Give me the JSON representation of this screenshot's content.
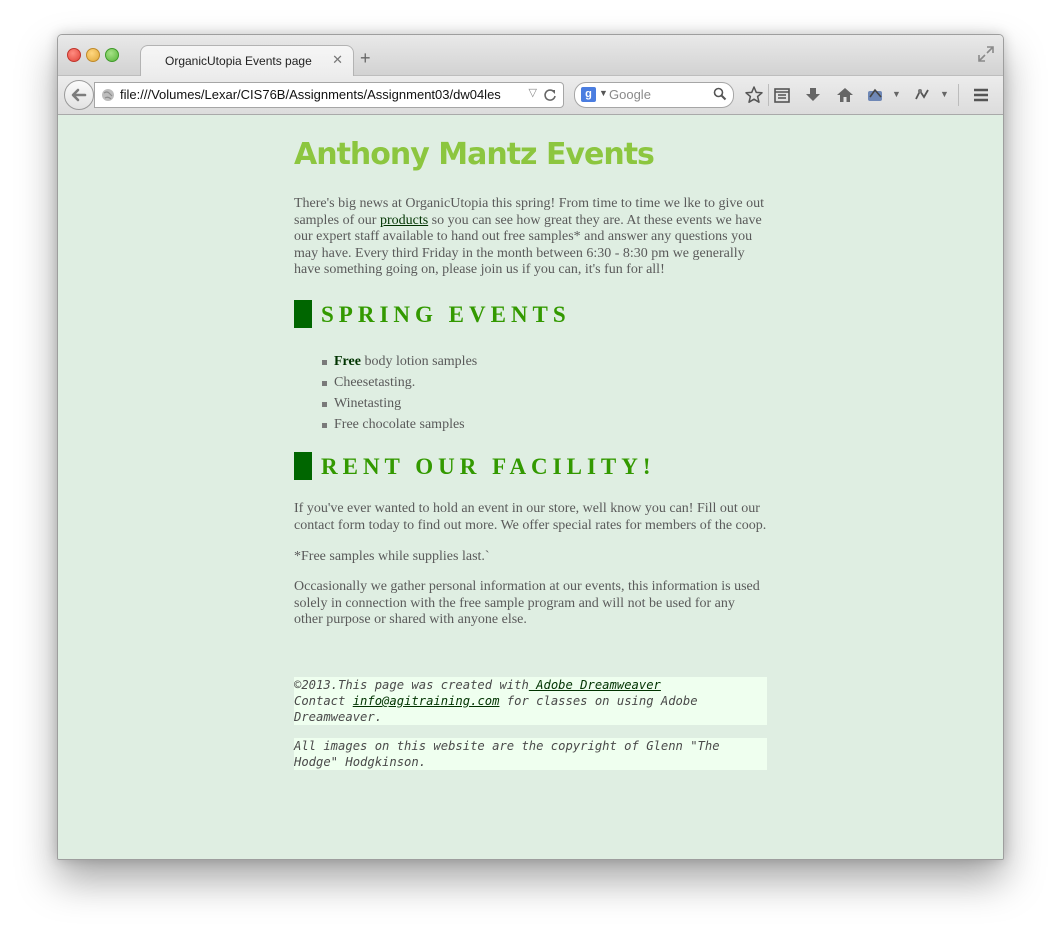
{
  "browser": {
    "tab_title": "OrganicUtopia Events page",
    "tab_close": "✕",
    "new_tab": "+",
    "url": "file:///Volumes/Lexar/CIS76B/Assignments/Assignment03/dw04les",
    "search_placeholder": "Google",
    "search_engine_logo": "g",
    "icons": [
      "back-icon",
      "globe-icon",
      "reload-icon",
      "search-icon",
      "bookmark-star-icon",
      "bookmarks-menu-icon",
      "downloads-icon",
      "home-icon",
      "addon-icon",
      "addon2-icon",
      "menu-icon",
      "fullscreen-icon"
    ]
  },
  "page": {
    "title": "Anthony Mantz Events",
    "intro": {
      "before_link": "There's big news at OrganicUtopia this spring! From time to time we lke to give out samples of our ",
      "link": "products",
      "after_link": " so you can see how great they are. At these events we have our expert staff available to hand out free samples* and answer any questions you may have. Every third Friday in the month between 6:30 - 8:30 pm we generally have something going on, please join us if you can, it's fun for all!"
    },
    "spring_heading": "SPRING EVENTS",
    "events": [
      {
        "strong": "Free",
        "text": " body lotion samples"
      },
      {
        "strong": "",
        "text": "Cheesetasting."
      },
      {
        "strong": "",
        "text": "Winetasting"
      },
      {
        "strong": "",
        "text": "Free chocolate samples"
      }
    ],
    "rent_heading": "RENT OUR FACILITY!",
    "rent_para": {
      "line1": "If you've ever wanted to hold an event in our store, well know you can! Fill out our",
      "line2": "contact form today to find out more. We offer special rates for members of the coop."
    },
    "free_note": "*Free samples while supplies last.`",
    "privacy": {
      "line1": "Occasionally we gather personal information at our events, this information is used",
      "line2": "solely in connection with the free sample program and will not be used for any",
      "line3": "other purpose or shared with anyone else."
    },
    "footer": {
      "created_prefix": "©2013.This page was created with",
      "created_link": " Adobe Dreamweaver",
      "contact_prefix": "Contact ",
      "contact_link": "info@agitraining.com",
      "contact_suffix": " for classes on using Adobe",
      "contact_line2": "Dreamweaver.",
      "images_line1": "All images on this website are the copyright of Glenn \"The",
      "images_line2": "Hodge\" Hodgkinson."
    }
  }
}
